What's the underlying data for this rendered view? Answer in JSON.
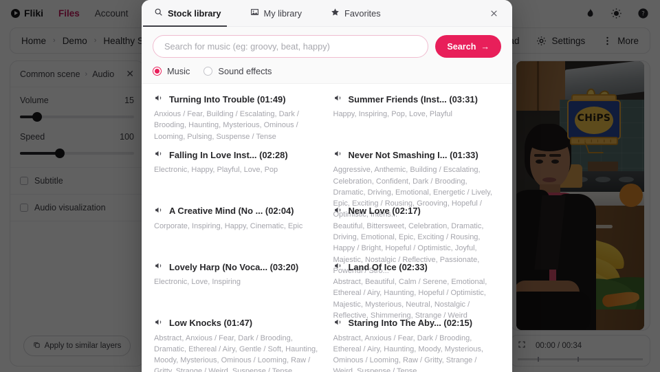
{
  "app": {
    "topnav": {
      "brand": "Fliki",
      "links": [
        {
          "label": "Files",
          "active": true
        },
        {
          "label": "Account",
          "active": false
        }
      ],
      "icons": [
        "flame-icon",
        "brightness-icon",
        "help-circle-icon"
      ]
    },
    "toolbar": {
      "breadcrumbs": [
        "Home",
        "Demo",
        "Healthy S"
      ],
      "separator": "›",
      "items": [
        {
          "label": "oad",
          "icon": "download-icon"
        },
        {
          "label": "Settings",
          "icon": "gear-icon"
        },
        {
          "label": "More",
          "icon": "dots-vertical-icon"
        }
      ]
    },
    "properties_panel": {
      "breadcrumb_parent": "Common scene",
      "breadcrumb_separator": "›",
      "breadcrumb_current": "Audio",
      "close_label": "✕",
      "volume": {
        "label": "Volume",
        "value": "15",
        "percent": 15
      },
      "speed": {
        "label": "Speed",
        "value": "100",
        "percent": 35
      },
      "subtitle": {
        "label": "Subtitle",
        "checked": false
      },
      "audio_visualization": {
        "label": "Audio visualization",
        "checked": false
      },
      "apply_button": "Apply to similar layers"
    },
    "player": {
      "current_time": "00:00",
      "total_time": "00:34",
      "time_display": "00:00 / 00:34",
      "fullscreen_icon": "expand-icon"
    },
    "preview": {
      "overlay_sticker_text": "CHiPS",
      "description": "Woman in business jacket standing in a kitchen with bananas and a chips jar sticker"
    }
  },
  "modal": {
    "tabs": [
      {
        "label": "Stock library",
        "icon": "search-icon",
        "active": true
      },
      {
        "label": "My library",
        "icon": "image-icon",
        "active": false
      },
      {
        "label": "Favorites",
        "icon": "star-icon",
        "active": false
      }
    ],
    "close_label": "✕",
    "search": {
      "placeholder": "Search for music (eg: groovy, beat, happy)",
      "value": "",
      "button_label": "Search",
      "button_arrow": "→",
      "accent_color": "#e81f5a"
    },
    "filters": [
      {
        "label": "Music",
        "selected": true
      },
      {
        "label": "Sound effects",
        "selected": false
      }
    ],
    "tracks": [
      {
        "title": "Turning Into Trouble (01:49)",
        "name": "Turning Into Trouble",
        "duration": "01:49",
        "tags": "Anxious / Fear, Building / Escalating, Dark / Brooding, Haunting, Mysterious, Ominous / Looming, Pulsing, Suspense / Tense",
        "icon": "speaker-icon"
      },
      {
        "title": "Summer Friends (Inst... (03:31)",
        "name": "Summer Friends (Inst...",
        "duration": "03:31",
        "tags": "Happy, Inspiring, Pop, Love, Playful",
        "icon": "speaker-icon"
      },
      {
        "title": "Falling In Love Inst... (02:28)",
        "name": "Falling In Love Inst...",
        "duration": "02:28",
        "tags": "Electronic, Happy, Playful, Love, Pop",
        "icon": "speaker-icon"
      },
      {
        "title": "Never Not Smashing I... (01:33)",
        "name": "Never Not Smashing I...",
        "duration": "01:33",
        "tags": "Aggressive, Anthemic, Building / Escalating, Celebration, Confident, Dark / Brooding, Dramatic, Driving, Emotional, Energetic / Lively, Epic, Exciting / Rousing, Grooving, Hopeful / Optimistic, Intens...",
        "icon": "speaker-icon"
      },
      {
        "title": "A Creative Mind (No ... (02:04)",
        "name": "A Creative Mind (No ...",
        "duration": "02:04",
        "tags": "Corporate, Inspiring, Happy, Cinematic, Epic",
        "icon": "speaker-icon"
      },
      {
        "title": "New Love (02:17)",
        "name": "New Love",
        "duration": "02:17",
        "tags": "Beautiful, Bittersweet, Celebration, Dramatic, Driving, Emotional, Epic, Exciting / Rousing, Happy / Bright, Hopeful / Optimistic, Joyful, Majestic, Nostalgic / Reflective, Passionate, Powerful / Stro...",
        "icon": "speaker-icon"
      },
      {
        "title": "Lovely Harp (No Voca... (03:20)",
        "name": "Lovely Harp (No Voca...",
        "duration": "03:20",
        "tags": "Electronic, Love, Inspiring",
        "icon": "speaker-icon"
      },
      {
        "title": "Land Of Ice (02:33)",
        "name": "Land Of Ice",
        "duration": "02:33",
        "tags": "Abstract, Beautiful, Calm / Serene, Emotional, Ethereal / Airy, Haunting, Hopeful / Optimistic, Majestic, Mysterious, Neutral, Nostalgic / Reflective, Shimmering, Strange / Weird",
        "icon": "speaker-icon"
      },
      {
        "title": "Low Knocks (01:47)",
        "name": "Low Knocks",
        "duration": "01:47",
        "tags": "Abstract, Anxious / Fear, Dark / Brooding, Dramatic, Ethereal / Airy, Gentle / Soft, Haunting, Moody, Mysterious, Ominous / Looming, Raw / Gritty, Strange / Weird, Suspense / Tense",
        "icon": "speaker-icon"
      },
      {
        "title": "Staring Into The Aby... (02:15)",
        "name": "Staring Into The Aby...",
        "duration": "02:15",
        "tags": "Abstract, Anxious / Fear, Dark / Brooding, Ethereal / Airy, Haunting, Moody, Mysterious, Ominous / Looming, Raw / Gritty, Strange / Weird, Suspense / Tense",
        "icon": "speaker-icon"
      }
    ]
  }
}
